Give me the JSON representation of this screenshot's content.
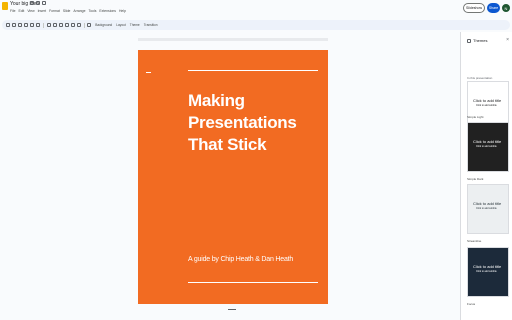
{
  "title_bar": {
    "doc_title": "Your big idea",
    "menu": [
      "File",
      "Edit",
      "View",
      "Insert",
      "Format",
      "Slide",
      "Arrange",
      "Tools",
      "Extensions",
      "Help"
    ],
    "slideshow_label": "Slideshow",
    "share_label": "Share",
    "avatar_initial": "N"
  },
  "toolbar": {
    "background_label": "Background",
    "layout_label": "Layout",
    "theme_label": "Theme",
    "transition_label": "Transition"
  },
  "slide": {
    "title": "Making Presentations That Stick",
    "subtitle": "A guide by Chip Heath & Dan Heath",
    "background_color": "#f26b22"
  },
  "themes_panel": {
    "heading": "Themes",
    "section_label": "In this presentation",
    "themes": [
      {
        "name": "Simple Light",
        "sample_title": "Click to add title",
        "sample_sub": "Click to add subtitle",
        "bg": "#ffffff",
        "fg": "#202124"
      },
      {
        "name": "Simple Dark",
        "sample_title": "Click to add title",
        "sample_sub": "Click to add subtitle",
        "bg": "#212121",
        "fg": "#ffffff"
      },
      {
        "name": "Streamline",
        "sample_title": "Click to add title",
        "sample_sub": "Click to add subtitle",
        "bg": "#eceff1",
        "fg": "#263238"
      },
      {
        "name": "Focus",
        "sample_title": "Click to add title",
        "sample_sub": "Click to add subtitle",
        "bg": "#1c2a3a",
        "fg": "#ffffff"
      }
    ]
  }
}
